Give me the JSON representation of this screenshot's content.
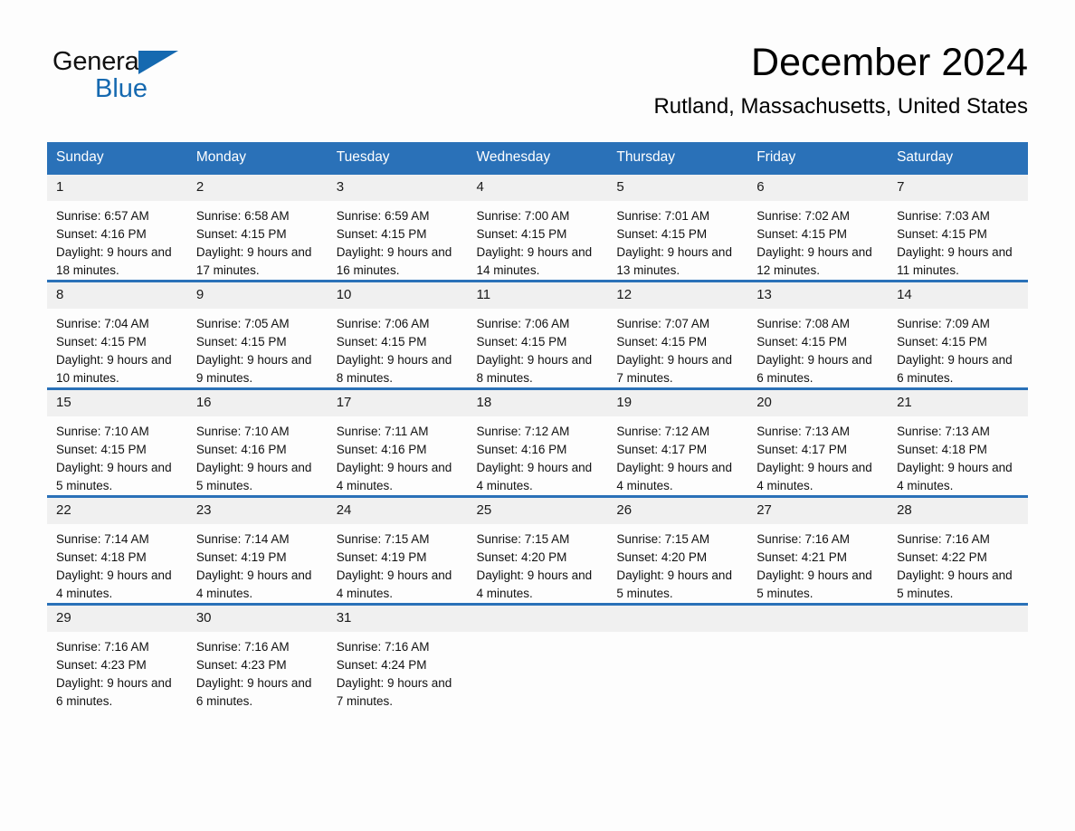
{
  "brand": {
    "word1": "General",
    "word2": "Blue",
    "triangle_color": "#1569b0"
  },
  "header": {
    "month_title": "December 2024",
    "location": "Rutland, Massachusetts, United States"
  },
  "theme": {
    "header_blue": "#2a71b8",
    "daynum_band": "#f0f0f0",
    "page_background": "#fdfdfd"
  },
  "weekday_headers": [
    "Sunday",
    "Monday",
    "Tuesday",
    "Wednesday",
    "Thursday",
    "Friday",
    "Saturday"
  ],
  "weeks": [
    [
      {
        "day": "1",
        "sunrise": "Sunrise: 6:57 AM",
        "sunset": "Sunset: 4:16 PM",
        "daylight": "Daylight: 9 hours and 18 minutes."
      },
      {
        "day": "2",
        "sunrise": "Sunrise: 6:58 AM",
        "sunset": "Sunset: 4:15 PM",
        "daylight": "Daylight: 9 hours and 17 minutes."
      },
      {
        "day": "3",
        "sunrise": "Sunrise: 6:59 AM",
        "sunset": "Sunset: 4:15 PM",
        "daylight": "Daylight: 9 hours and 16 minutes."
      },
      {
        "day": "4",
        "sunrise": "Sunrise: 7:00 AM",
        "sunset": "Sunset: 4:15 PM",
        "daylight": "Daylight: 9 hours and 14 minutes."
      },
      {
        "day": "5",
        "sunrise": "Sunrise: 7:01 AM",
        "sunset": "Sunset: 4:15 PM",
        "daylight": "Daylight: 9 hours and 13 minutes."
      },
      {
        "day": "6",
        "sunrise": "Sunrise: 7:02 AM",
        "sunset": "Sunset: 4:15 PM",
        "daylight": "Daylight: 9 hours and 12 minutes."
      },
      {
        "day": "7",
        "sunrise": "Sunrise: 7:03 AM",
        "sunset": "Sunset: 4:15 PM",
        "daylight": "Daylight: 9 hours and 11 minutes."
      }
    ],
    [
      {
        "day": "8",
        "sunrise": "Sunrise: 7:04 AM",
        "sunset": "Sunset: 4:15 PM",
        "daylight": "Daylight: 9 hours and 10 minutes."
      },
      {
        "day": "9",
        "sunrise": "Sunrise: 7:05 AM",
        "sunset": "Sunset: 4:15 PM",
        "daylight": "Daylight: 9 hours and 9 minutes."
      },
      {
        "day": "10",
        "sunrise": "Sunrise: 7:06 AM",
        "sunset": "Sunset: 4:15 PM",
        "daylight": "Daylight: 9 hours and 8 minutes."
      },
      {
        "day": "11",
        "sunrise": "Sunrise: 7:06 AM",
        "sunset": "Sunset: 4:15 PM",
        "daylight": "Daylight: 9 hours and 8 minutes."
      },
      {
        "day": "12",
        "sunrise": "Sunrise: 7:07 AM",
        "sunset": "Sunset: 4:15 PM",
        "daylight": "Daylight: 9 hours and 7 minutes."
      },
      {
        "day": "13",
        "sunrise": "Sunrise: 7:08 AM",
        "sunset": "Sunset: 4:15 PM",
        "daylight": "Daylight: 9 hours and 6 minutes."
      },
      {
        "day": "14",
        "sunrise": "Sunrise: 7:09 AM",
        "sunset": "Sunset: 4:15 PM",
        "daylight": "Daylight: 9 hours and 6 minutes."
      }
    ],
    [
      {
        "day": "15",
        "sunrise": "Sunrise: 7:10 AM",
        "sunset": "Sunset: 4:15 PM",
        "daylight": "Daylight: 9 hours and 5 minutes."
      },
      {
        "day": "16",
        "sunrise": "Sunrise: 7:10 AM",
        "sunset": "Sunset: 4:16 PM",
        "daylight": "Daylight: 9 hours and 5 minutes."
      },
      {
        "day": "17",
        "sunrise": "Sunrise: 7:11 AM",
        "sunset": "Sunset: 4:16 PM",
        "daylight": "Daylight: 9 hours and 4 minutes."
      },
      {
        "day": "18",
        "sunrise": "Sunrise: 7:12 AM",
        "sunset": "Sunset: 4:16 PM",
        "daylight": "Daylight: 9 hours and 4 minutes."
      },
      {
        "day": "19",
        "sunrise": "Sunrise: 7:12 AM",
        "sunset": "Sunset: 4:17 PM",
        "daylight": "Daylight: 9 hours and 4 minutes."
      },
      {
        "day": "20",
        "sunrise": "Sunrise: 7:13 AM",
        "sunset": "Sunset: 4:17 PM",
        "daylight": "Daylight: 9 hours and 4 minutes."
      },
      {
        "day": "21",
        "sunrise": "Sunrise: 7:13 AM",
        "sunset": "Sunset: 4:18 PM",
        "daylight": "Daylight: 9 hours and 4 minutes."
      }
    ],
    [
      {
        "day": "22",
        "sunrise": "Sunrise: 7:14 AM",
        "sunset": "Sunset: 4:18 PM",
        "daylight": "Daylight: 9 hours and 4 minutes."
      },
      {
        "day": "23",
        "sunrise": "Sunrise: 7:14 AM",
        "sunset": "Sunset: 4:19 PM",
        "daylight": "Daylight: 9 hours and 4 minutes."
      },
      {
        "day": "24",
        "sunrise": "Sunrise: 7:15 AM",
        "sunset": "Sunset: 4:19 PM",
        "daylight": "Daylight: 9 hours and 4 minutes."
      },
      {
        "day": "25",
        "sunrise": "Sunrise: 7:15 AM",
        "sunset": "Sunset: 4:20 PM",
        "daylight": "Daylight: 9 hours and 4 minutes."
      },
      {
        "day": "26",
        "sunrise": "Sunrise: 7:15 AM",
        "sunset": "Sunset: 4:20 PM",
        "daylight": "Daylight: 9 hours and 5 minutes."
      },
      {
        "day": "27",
        "sunrise": "Sunrise: 7:16 AM",
        "sunset": "Sunset: 4:21 PM",
        "daylight": "Daylight: 9 hours and 5 minutes."
      },
      {
        "day": "28",
        "sunrise": "Sunrise: 7:16 AM",
        "sunset": "Sunset: 4:22 PM",
        "daylight": "Daylight: 9 hours and 5 minutes."
      }
    ],
    [
      {
        "day": "29",
        "sunrise": "Sunrise: 7:16 AM",
        "sunset": "Sunset: 4:23 PM",
        "daylight": "Daylight: 9 hours and 6 minutes."
      },
      {
        "day": "30",
        "sunrise": "Sunrise: 7:16 AM",
        "sunset": "Sunset: 4:23 PM",
        "daylight": "Daylight: 9 hours and 6 minutes."
      },
      {
        "day": "31",
        "sunrise": "Sunrise: 7:16 AM",
        "sunset": "Sunset: 4:24 PM",
        "daylight": "Daylight: 9 hours and 7 minutes."
      },
      {
        "day": "",
        "sunrise": "",
        "sunset": "",
        "daylight": ""
      },
      {
        "day": "",
        "sunrise": "",
        "sunset": "",
        "daylight": ""
      },
      {
        "day": "",
        "sunrise": "",
        "sunset": "",
        "daylight": ""
      },
      {
        "day": "",
        "sunrise": "",
        "sunset": "",
        "daylight": ""
      }
    ]
  ]
}
